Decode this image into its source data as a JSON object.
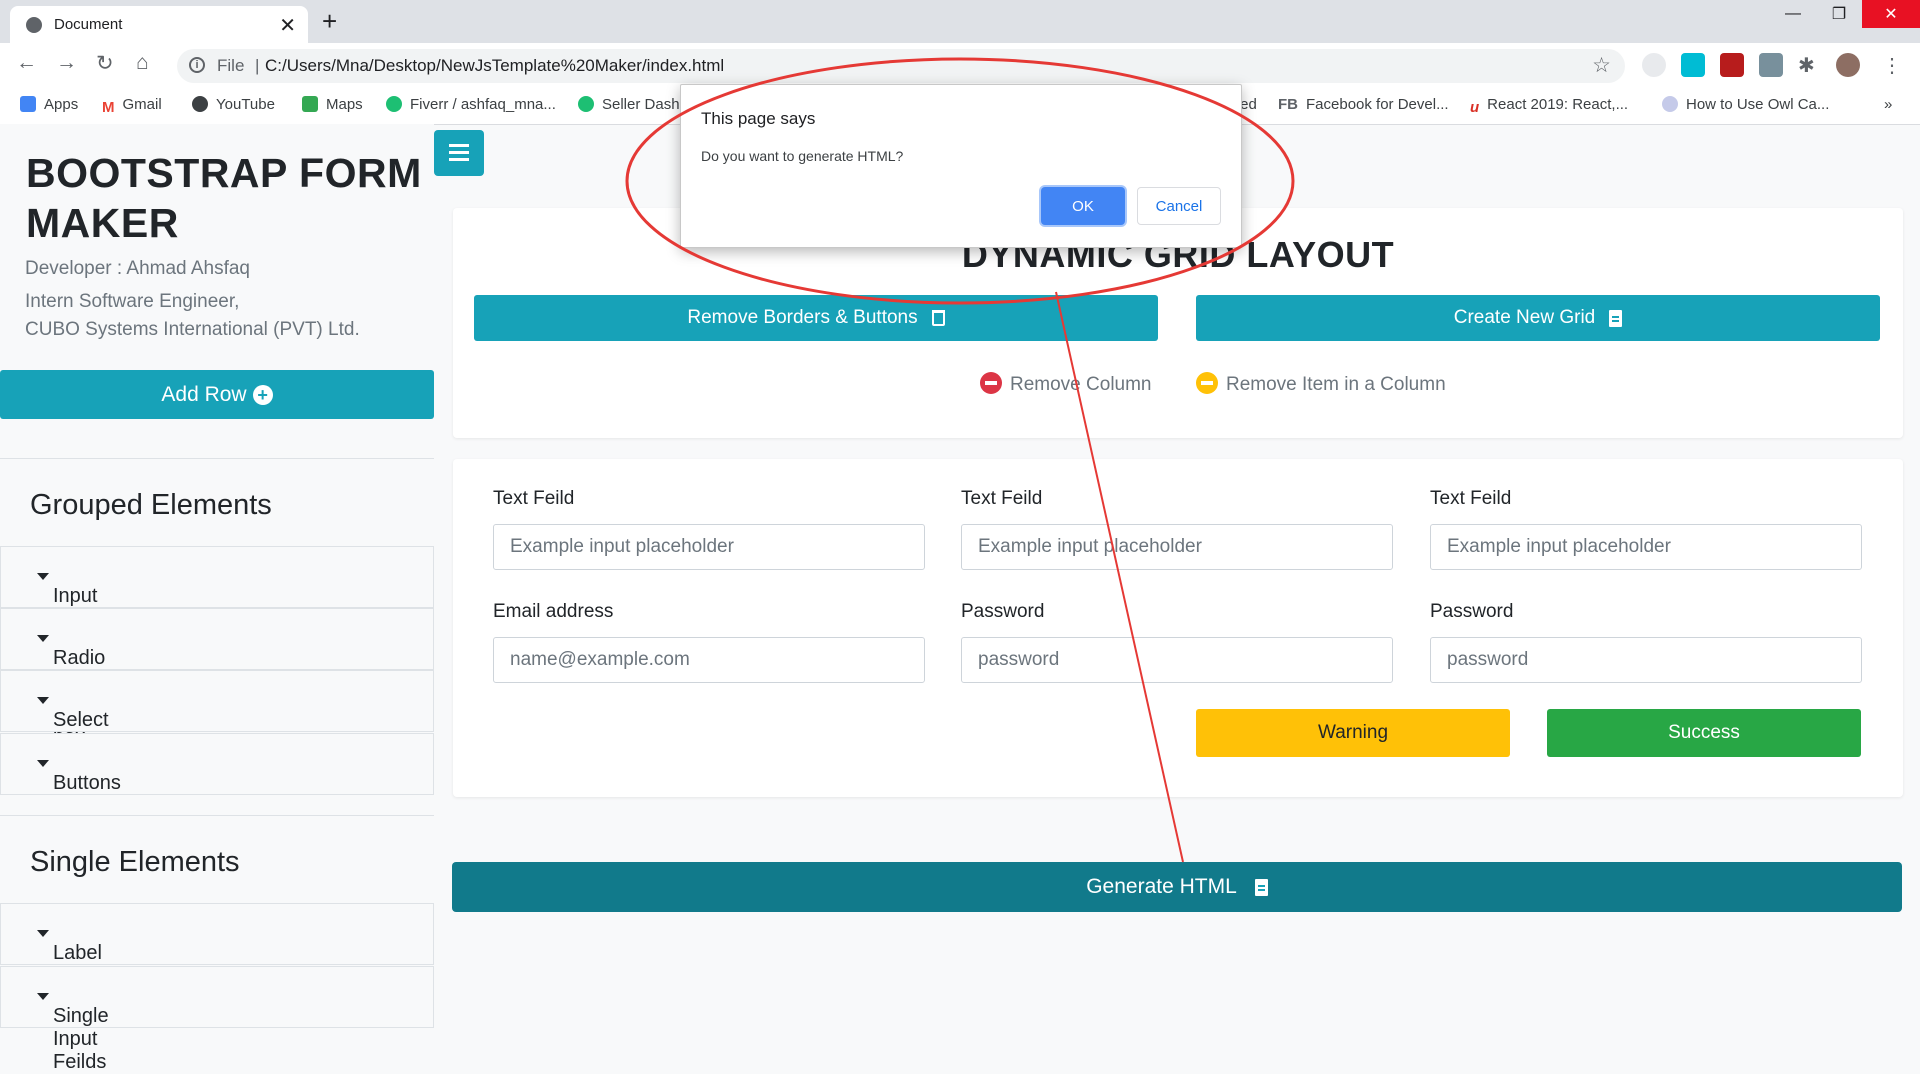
{
  "browser": {
    "tab_title": "Document",
    "file_label": "File",
    "url": "C:/Users/Mna/Desktop/NewJsTemplate%20Maker/index.html",
    "bookmarks": [
      {
        "label": "Apps",
        "color": "#ea4335"
      },
      {
        "label": "Gmail",
        "color": "#ea4335"
      },
      {
        "label": "YouTube",
        "color": "#3c4043"
      },
      {
        "label": "Maps",
        "color": "#34a853"
      },
      {
        "label": "Fiverr / ashfaq_mna...",
        "color": "#1dbf73"
      },
      {
        "label": "Seller Dash",
        "color": "#1dbf73"
      },
      {
        "label": "ted",
        "color": "#3c4043"
      },
      {
        "label": "Facebook for Devel...",
        "color": "#5f6368"
      },
      {
        "label": "React 2019: React,...",
        "color": "#d93025"
      },
      {
        "label": "How to Use Owl Ca...",
        "color": "#5f6368"
      }
    ],
    "bookmark_fb_prefix": "FB",
    "overflow": "»"
  },
  "sidebar": {
    "brand_title": "BOOTSTRAP FORM MAKER",
    "developer": "Developer : Ahmad Ahsfaq",
    "role": "Intern Software Engineer,",
    "company": "CUBO Systems International (PVT) Ltd.",
    "add_row_label": "Add Row",
    "grouped_heading": "Grouped Elements",
    "grouped_items": [
      "Input Feilds",
      "Radio & Check box Feilds",
      "Select Feild",
      "Buttons"
    ],
    "single_heading": "Single Elements",
    "single_items": [
      "Label and Check Feilds",
      "Single Input Feilds"
    ]
  },
  "main": {
    "grid_title": "DYNAMIC GRID LAYOUT",
    "remove_borders_label": "Remove Borders & Buttons",
    "create_grid_label": "Create New Grid",
    "legend_remove_column": "Remove Column",
    "legend_remove_item": "Remove Item in a Column",
    "form": {
      "text_label": "Text Feild",
      "text_placeholder": "Example input placeholder",
      "email_label": "Email address",
      "email_placeholder": "name@example.com",
      "password_label": "Password",
      "password_placeholder": "password",
      "warning_label": "Warning",
      "success_label": "Success"
    },
    "generate_label": "Generate HTML"
  },
  "dialog": {
    "title": "This page says",
    "message": "Do you want to generate HTML?",
    "ok_label": "OK",
    "cancel_label": "Cancel"
  },
  "colors": {
    "primary": "#17a2b8",
    "generate": "#117a8b",
    "warning": "#ffc107",
    "success": "#28a745",
    "danger": "#dc3545",
    "annotation": "#e53935"
  }
}
